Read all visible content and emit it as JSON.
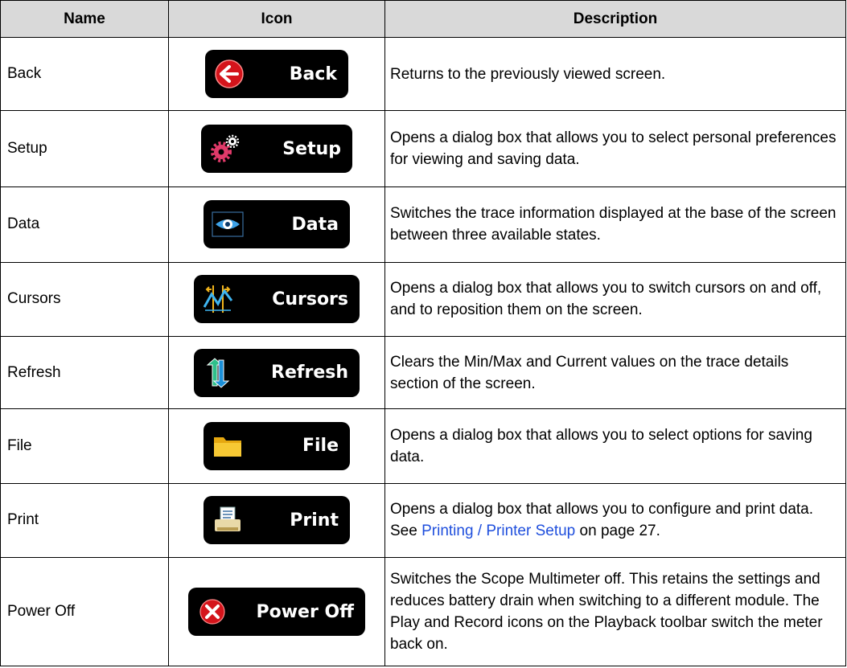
{
  "headers": {
    "name": "Name",
    "icon": "Icon",
    "description": "Description"
  },
  "rows": [
    {
      "name": "Back",
      "icon_label": "Back",
      "icon": "back-arrow-icon",
      "description": "Returns to the previously viewed screen."
    },
    {
      "name": "Setup",
      "icon_label": "Setup",
      "icon": "gears-icon",
      "description": "Opens a dialog box that allows you to select personal preferences for viewing and saving data."
    },
    {
      "name": "Data",
      "icon_label": "Data",
      "icon": "eye-icon",
      "description": "Switches the trace information displayed at the base of the screen between three available states."
    },
    {
      "name": "Cursors",
      "icon_label": "Cursors",
      "icon": "cursors-icon",
      "description": "Opens a dialog box that allows you to switch cursors on and off, and to reposition them on the screen."
    },
    {
      "name": "Refresh",
      "icon_label": "Refresh",
      "icon": "refresh-arrows-icon",
      "description": "Clears the Min/Max and Current values on the trace details section of the screen."
    },
    {
      "name": "File",
      "icon_label": "File",
      "icon": "folder-icon",
      "description": "Opens a dialog box that allows you to select options for saving data."
    },
    {
      "name": "Print",
      "icon_label": "Print",
      "icon": "printer-icon",
      "description_pre": "Opens a dialog box that allows you to configure and print data. See ",
      "description_link": "Printing / Printer Setup",
      "description_post": " on page 27."
    },
    {
      "name": "Power Off",
      "icon_label": "Power Off",
      "icon": "power-off-x-icon",
      "description": "Switches the Scope Multimeter off. This retains the settings and reduces battery drain when switching to a different module. The Play and Record icons on the Playback toolbar switch the meter back on."
    }
  ],
  "colors": {
    "link": "#1f4fdd",
    "header_bg": "#d9d9d9",
    "button_bg": "#000000"
  }
}
